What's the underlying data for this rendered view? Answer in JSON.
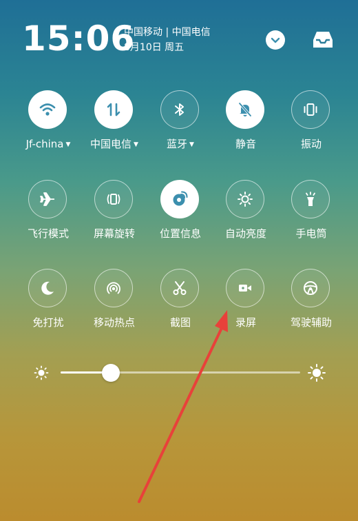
{
  "status": {
    "time": "15:06",
    "carriers": "中国移动 | 中国电信",
    "date": "8月10日 周五"
  },
  "toggles": [
    {
      "label": "Jf-china",
      "icon": "wifi-icon",
      "active": true,
      "dropdown": true
    },
    {
      "label": "中国电信",
      "icon": "mobile-data-icon",
      "active": true,
      "dropdown": true
    },
    {
      "label": "蓝牙",
      "icon": "bluetooth-icon",
      "active": false,
      "dropdown": true
    },
    {
      "label": "静音",
      "icon": "mute-bell-icon",
      "active": true,
      "dropdown": false
    },
    {
      "label": "振动",
      "icon": "vibrate-icon",
      "active": false,
      "dropdown": false
    },
    {
      "label": "飞行模式",
      "icon": "airplane-icon",
      "active": false,
      "dropdown": false
    },
    {
      "label": "屏幕旋转",
      "icon": "screen-rotation-icon",
      "active": false,
      "dropdown": false
    },
    {
      "label": "位置信息",
      "icon": "location-icon",
      "active": true,
      "dropdown": false
    },
    {
      "label": "自动亮度",
      "icon": "auto-brightness-icon",
      "active": false,
      "dropdown": false
    },
    {
      "label": "手电筒",
      "icon": "flashlight-icon",
      "active": false,
      "dropdown": false
    },
    {
      "label": "免打扰",
      "icon": "moon-icon",
      "active": false,
      "dropdown": false
    },
    {
      "label": "移动热点",
      "icon": "hotspot-icon",
      "active": false,
      "dropdown": false
    },
    {
      "label": "截图",
      "icon": "scissors-icon",
      "active": false,
      "dropdown": false
    },
    {
      "label": "录屏",
      "icon": "screen-record-icon",
      "active": false,
      "dropdown": false
    },
    {
      "label": "驾驶辅助",
      "icon": "steering-wheel-icon",
      "active": false,
      "dropdown": false
    }
  ],
  "brightness": {
    "level": 0.21
  },
  "colors": {
    "active_icon": "#3c8fae",
    "annotation_arrow": "#e8413a"
  }
}
